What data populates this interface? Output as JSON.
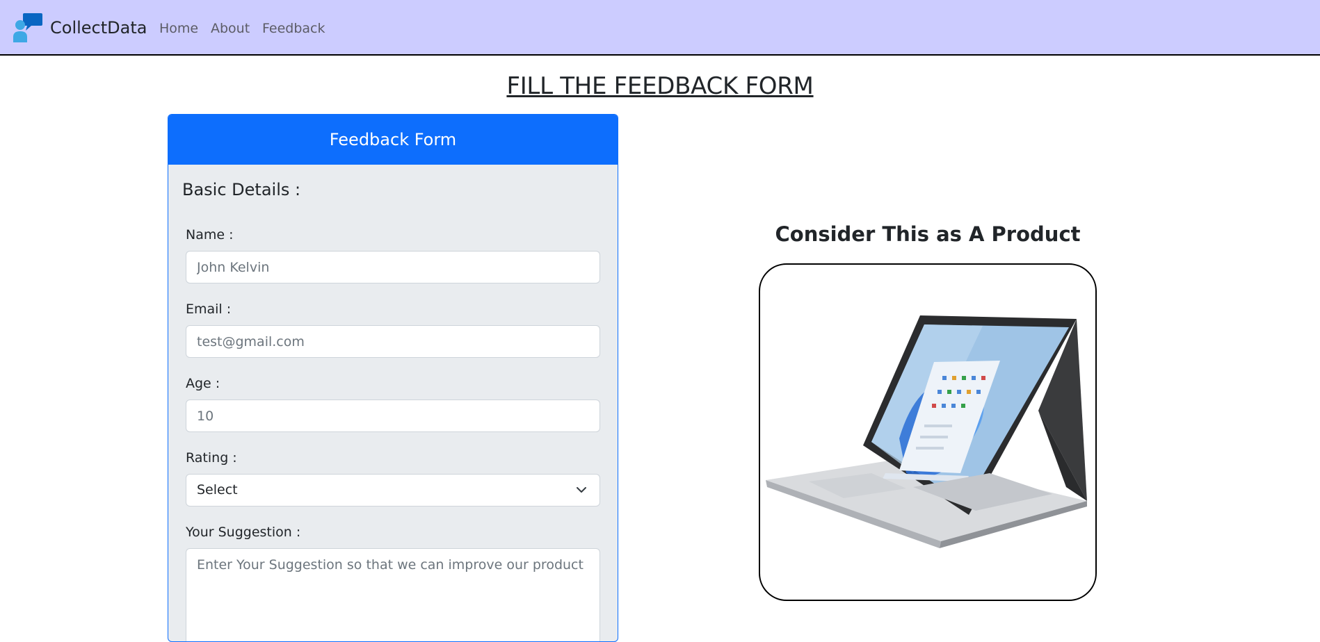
{
  "navbar": {
    "brand": "CollectData",
    "links": [
      "Home",
      "About",
      "Feedback"
    ]
  },
  "page": {
    "heading": "FILL THE FEEDBACK FORM"
  },
  "form": {
    "header": "Feedback Form",
    "section_title": "Basic Details :",
    "name_label": "Name :",
    "name_placeholder": "John Kelvin",
    "email_label": "Email :",
    "email_placeholder": "test@gmail.com",
    "age_label": "Age :",
    "age_placeholder": "10",
    "rating_label": "Rating :",
    "rating_selected": "Select",
    "suggestion_label": "Your Suggestion :",
    "suggestion_placeholder": "Enter Your Suggestion so that we can improve our product"
  },
  "product": {
    "title": "Consider This as A Product",
    "image_icon": "laptop-image"
  },
  "colors": {
    "navbar_bg": "#ccccff",
    "primary": "#0d6efd",
    "card_bg": "#e9ecef"
  }
}
